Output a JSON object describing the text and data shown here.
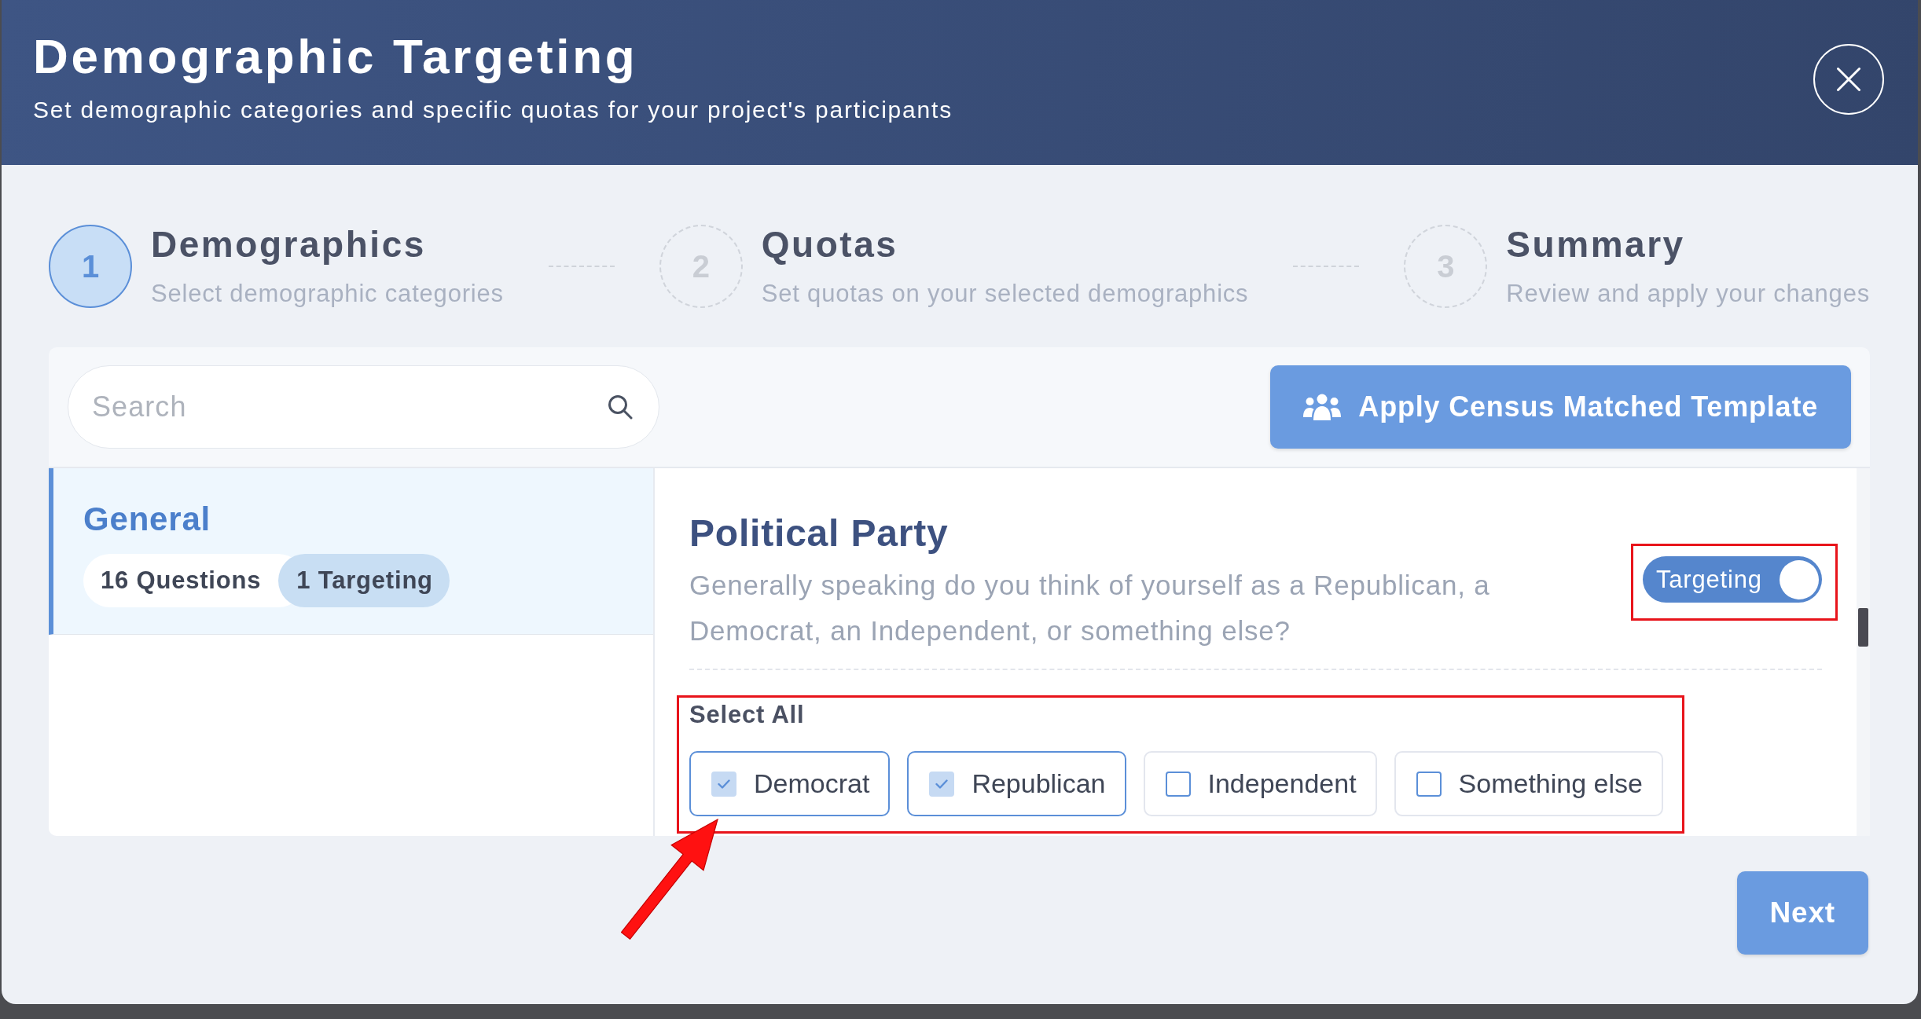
{
  "dialog": {
    "title": "Demographic Targeting",
    "subtitle": "Set demographic categories and specific quotas for your project's participants"
  },
  "steps": [
    {
      "number": "1",
      "title": "Demographics",
      "subtitle": "Select demographic categories",
      "selected": true
    },
    {
      "number": "2",
      "title": "Quotas",
      "subtitle": "Set quotas on your selected demographics",
      "selected": false
    },
    {
      "number": "3",
      "title": "Summary",
      "subtitle": "Review and apply your changes",
      "selected": false
    }
  ],
  "search": {
    "placeholder": "Search"
  },
  "template_button": {
    "label": "Apply Census Matched Template"
  },
  "sidebar": {
    "items": [
      {
        "title": "General",
        "selected": true,
        "badges": [
          {
            "kind": "count",
            "label": "16 Questions"
          },
          {
            "kind": "targeting",
            "label": "1 Targeting"
          }
        ]
      }
    ]
  },
  "question": {
    "title": "Political Party",
    "text": "Generally speaking do you think of yourself as a Republican, a Democrat, an Independent, or something else?",
    "toggle": {
      "label": "Targeting",
      "on": true,
      "highlighted": true
    },
    "select_all": {
      "label": "Select All"
    },
    "options_highlighted": true,
    "options": [
      {
        "label": "Democrat",
        "checked": true,
        "pointed_at": true
      },
      {
        "label": "Republican",
        "checked": true,
        "pointed_at": false
      },
      {
        "label": "Independent",
        "checked": false,
        "pointed_at": false
      },
      {
        "label": "Something else",
        "checked": false,
        "pointed_at": false
      }
    ]
  },
  "next_button": {
    "label": "Next"
  }
}
